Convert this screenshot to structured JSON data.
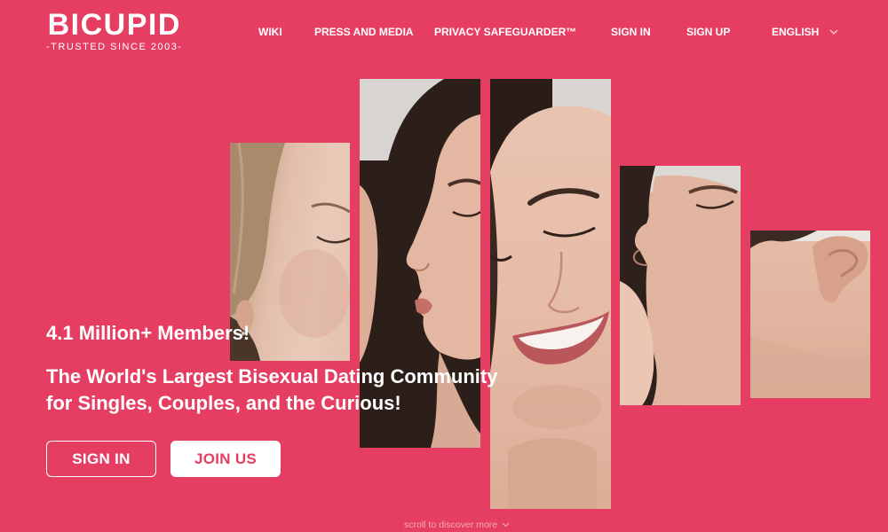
{
  "page": {
    "background_color": "#E53E62",
    "accent_color": "#E53E62",
    "text_color": "#FFFFFF"
  },
  "logo": {
    "name": "BICUPID",
    "tagline": "-TRUSTED SINCE 2003-"
  },
  "nav": {
    "items": [
      {
        "label": "WIKI"
      },
      {
        "label": "PRESS AND MEDIA"
      },
      {
        "label": "PRIVACY SAFEGUARDER™"
      },
      {
        "label": "SIGN IN"
      },
      {
        "label": "SIGN UP"
      }
    ],
    "language": {
      "label": "ENGLISH",
      "icon": "chevron-down-icon"
    }
  },
  "hero": {
    "members": "4.1 Million+ Members!",
    "headline": [
      "The World's Largest Bisexual Dating Community",
      "for Singles, Couples, and the Curious!"
    ],
    "buttons": {
      "sign_in": "SIGN IN",
      "join": "JOIN US"
    }
  },
  "scroll_hint": {
    "label": "scroll to discover more",
    "icon": "chevron-down-icon"
  }
}
